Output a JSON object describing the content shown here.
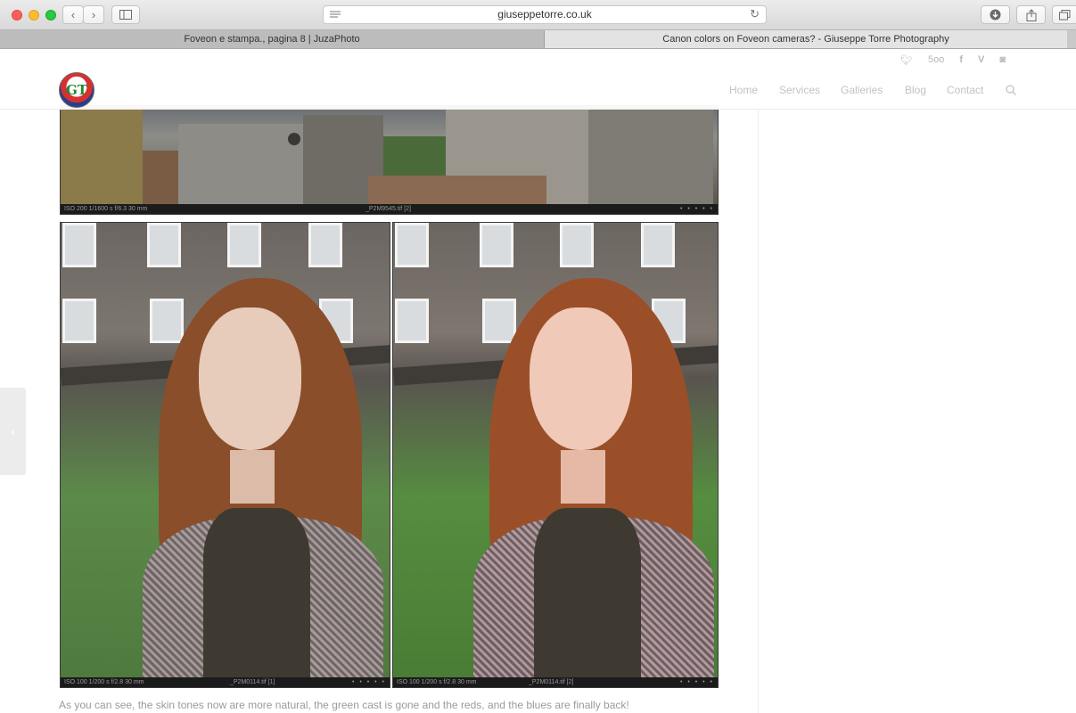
{
  "browser": {
    "url": "giuseppetorre.co.uk",
    "tabs": [
      {
        "label": "Foveon e stampa., pagina 8 | JuzaPhoto",
        "active": false
      },
      {
        "label": "Canon colors on Foveon cameras? - Giuseppe Torre Photography",
        "active": true
      }
    ]
  },
  "site": {
    "logo_text": "GT",
    "social": [
      "twitter-icon",
      "500px-icon",
      "facebook-icon",
      "vimeo-icon",
      "instagram-icon"
    ],
    "social_500": "5oo",
    "nav": [
      "Home",
      "Services",
      "Galleries",
      "Blog",
      "Contact"
    ]
  },
  "photos": [
    {
      "left": "ISO 200  1/1600 s  f/6.3  30 mm",
      "file": "_P2M9545.tif [2]"
    },
    {
      "left": "ISO 100  1/200 s  f/2.8  30 mm",
      "file": "_P2M0114.tif [1]"
    },
    {
      "left": "ISO 100  1/200 s  f/2.8  30 mm",
      "file": "_P2M0114.tif [2]"
    }
  ],
  "filmstrip_dots": "• • • • •",
  "body_text": "As you can see, the skin tones now are more natural, the green cast is gone and the reds, and the blues are finally back!",
  "colors": {
    "accent_nav": "#c2c2c2",
    "text": "#9a9a9a"
  }
}
